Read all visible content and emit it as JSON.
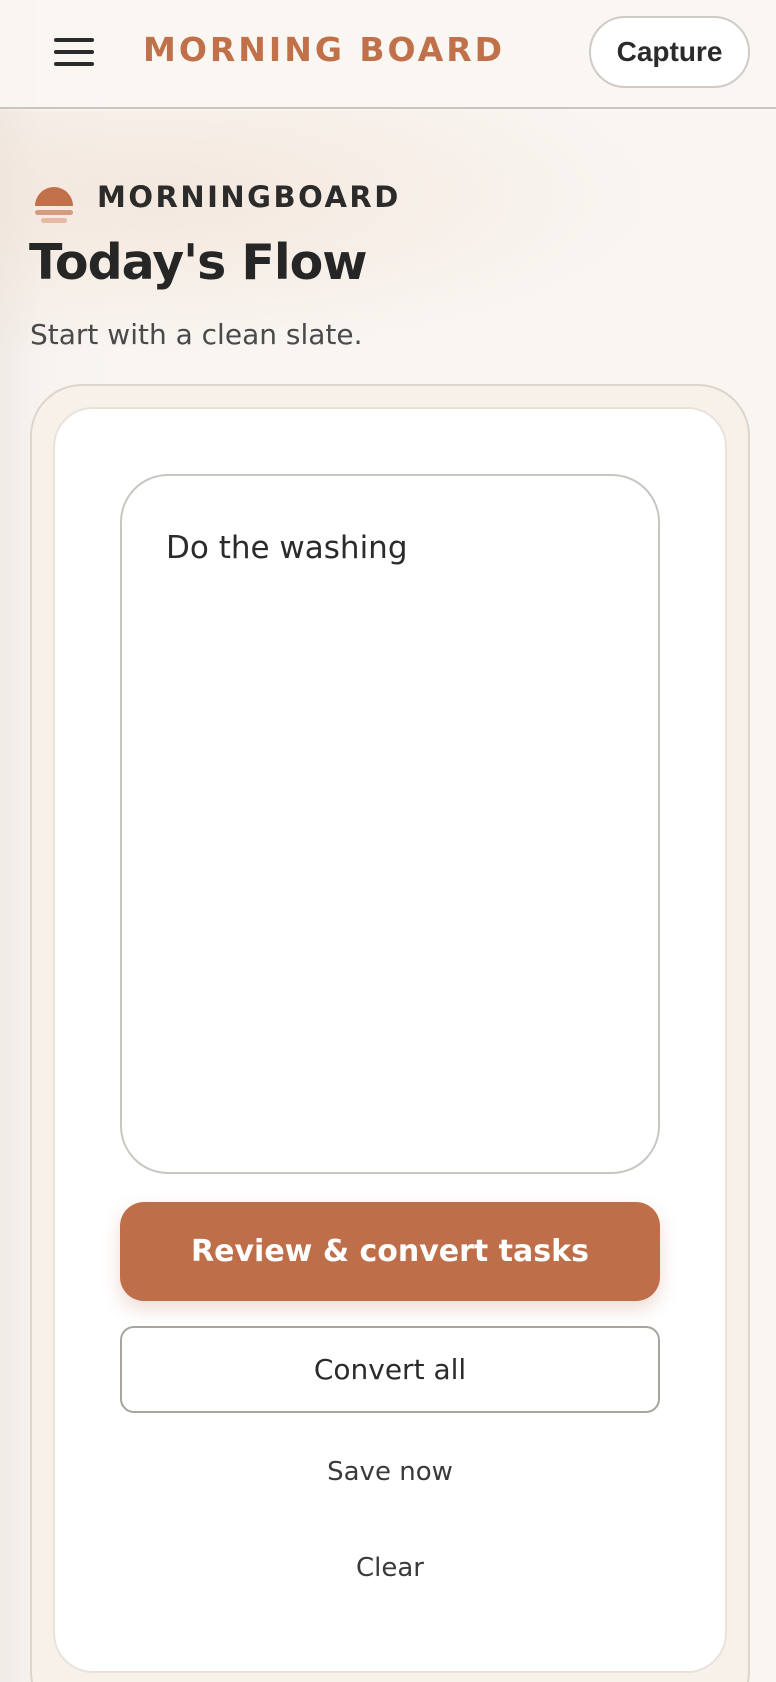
{
  "header": {
    "menu_icon": "hamburger-menu-icon",
    "brand": "MORNING BOARD",
    "capture_label": "Capture"
  },
  "hero": {
    "logo_icon": "sunrise-icon",
    "logo_text": "MORNINGBOARD",
    "title": "Today's Flow",
    "subtitle": "Start with a clean slate."
  },
  "editor": {
    "value": "Do the washing"
  },
  "actions": {
    "review_convert_label": "Review & convert tasks",
    "convert_all_label": "Convert all",
    "save_now_label": "Save now",
    "clear_label": "Clear"
  },
  "colors": {
    "accent": "#be6f4a",
    "background": "#f9f6f2"
  }
}
